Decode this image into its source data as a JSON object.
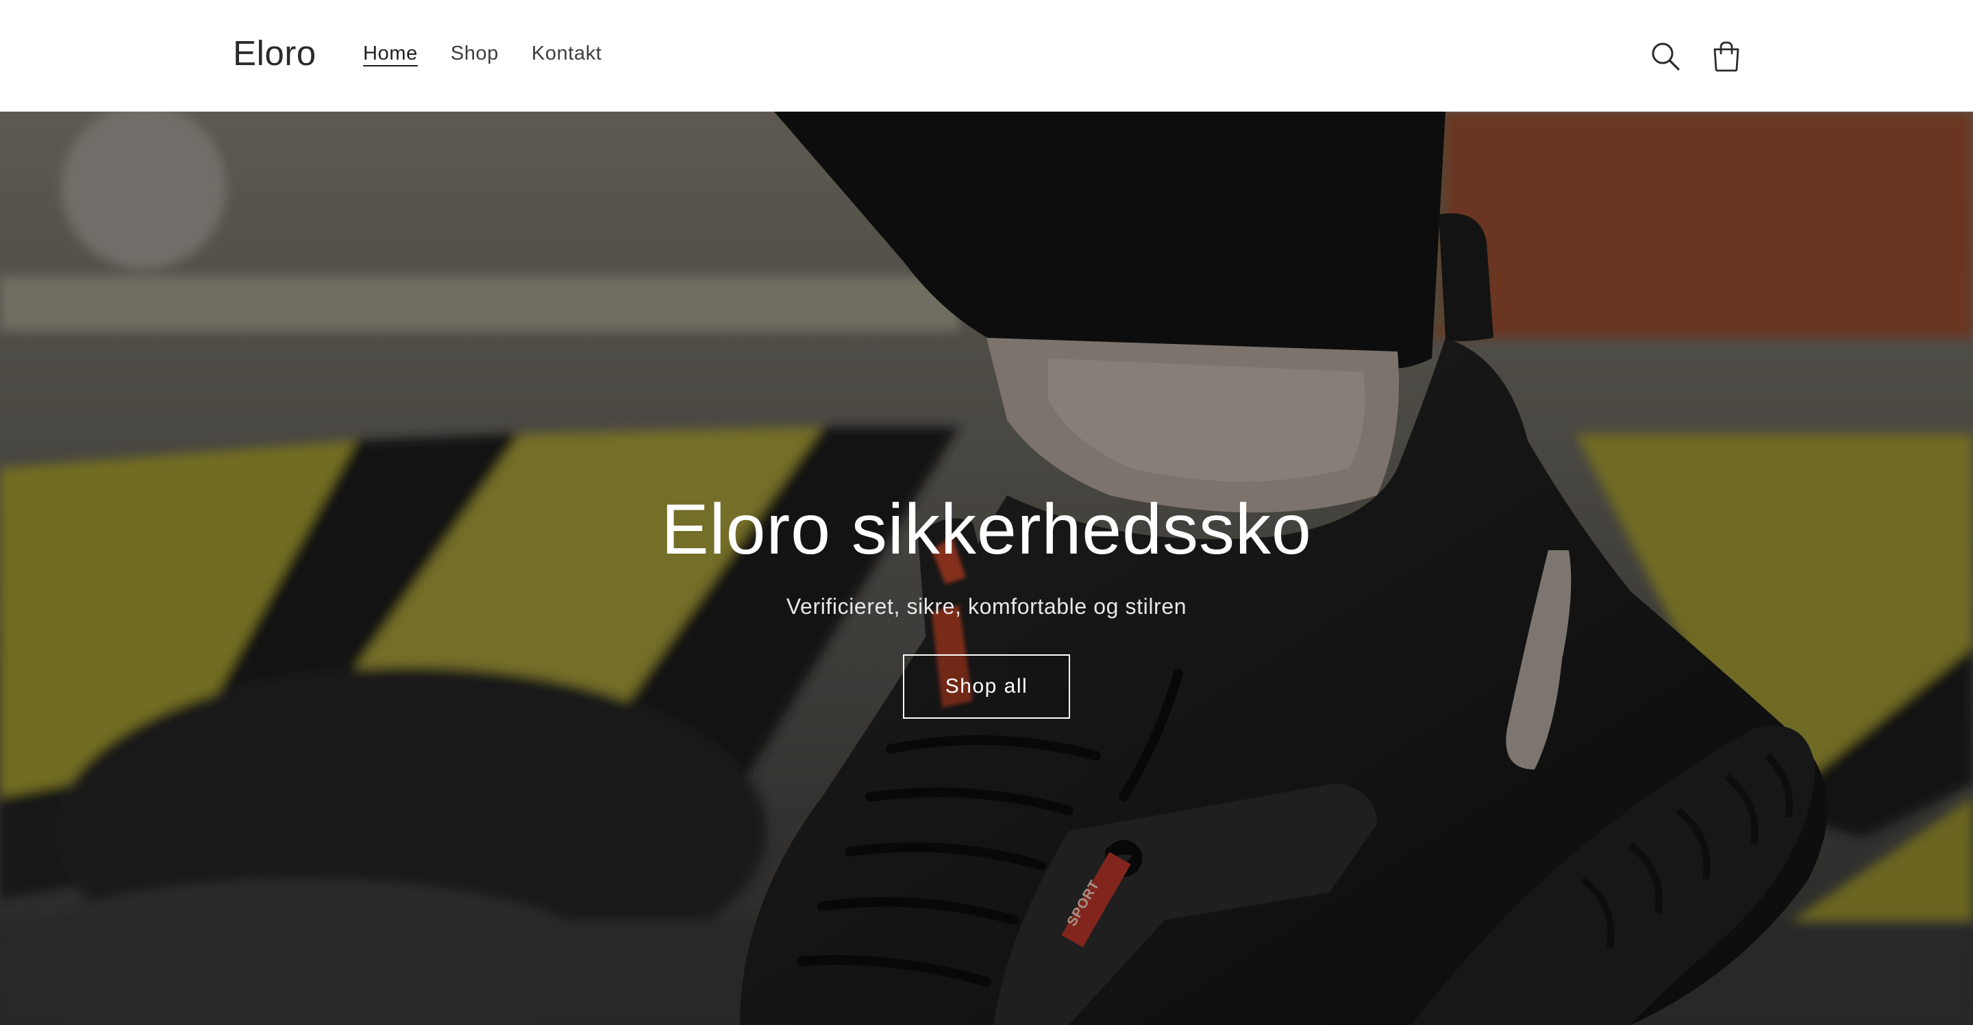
{
  "header": {
    "logo": "Eloro",
    "nav": [
      {
        "label": "Home",
        "active": true
      },
      {
        "label": "Shop",
        "active": false
      },
      {
        "label": "Kontakt",
        "active": false
      }
    ],
    "icons": {
      "search": "search-icon",
      "cart": "cart-icon"
    }
  },
  "hero": {
    "title": "Eloro sikkerhedssko",
    "subtitle": "Verificieret, sikre, komfortable og stilren",
    "button_label": "Shop all",
    "image": "black-sneaker-safety-shoe-photo",
    "shoe_badge": "SPORT"
  },
  "colors": {
    "text_dark": "#2b2b2b",
    "hero_text": "#ffffff",
    "stripe_yellow": "#9a8f2c",
    "accent_orange": "#c4462c"
  }
}
